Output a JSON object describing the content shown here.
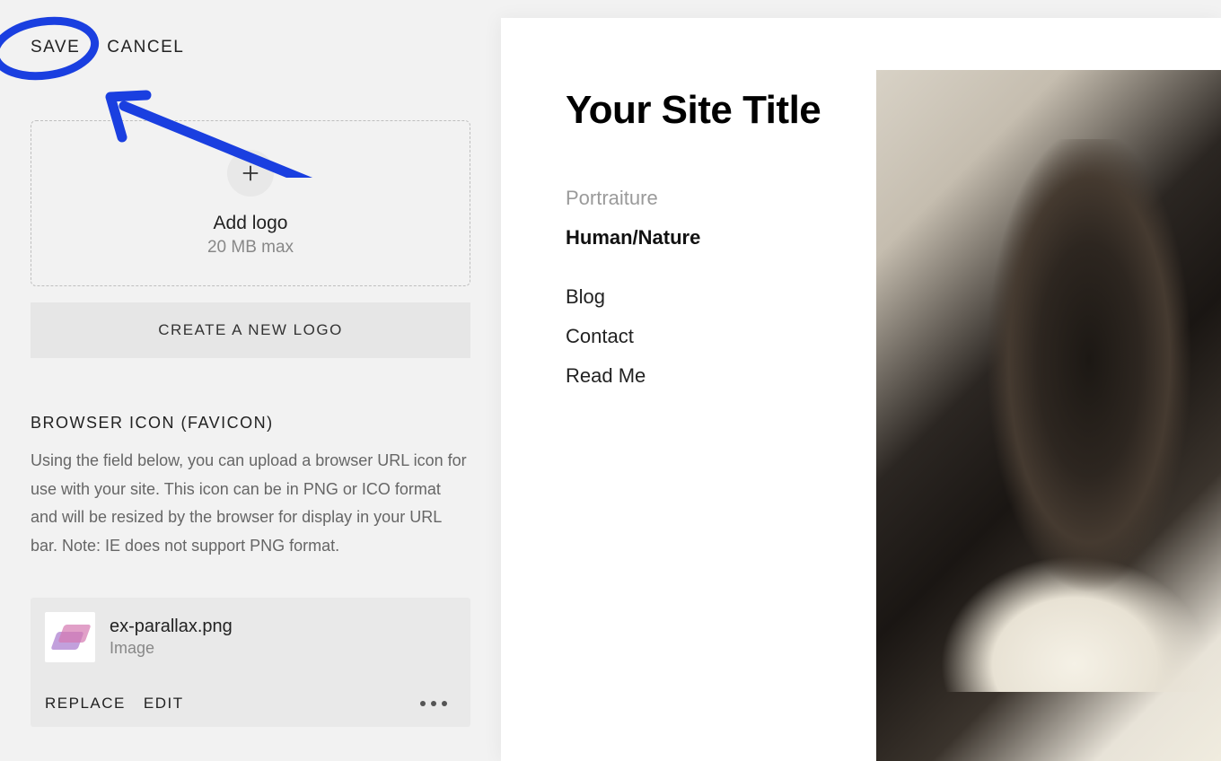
{
  "actions": {
    "save": "SAVE",
    "cancel": "CANCEL"
  },
  "logo_upload": {
    "title": "Add logo",
    "subtitle": "20 MB max",
    "create_button": "CREATE A NEW LOGO"
  },
  "favicon_section": {
    "heading": "BROWSER ICON (FAVICON)",
    "description": "Using the field below, you can upload a browser URL icon for use with your site. This icon can be in PNG or ICO format and will be resized by the browser for display in your URL bar. Note: IE does not support PNG format."
  },
  "file": {
    "name": "ex-parallax.png",
    "type": "Image",
    "actions": {
      "replace": "REPLACE",
      "edit": "EDIT"
    }
  },
  "preview": {
    "site_title": "Your Site Title",
    "nav": {
      "portraiture": "Portraiture",
      "human_nature": "Human/Nature",
      "blog": "Blog",
      "contact": "Contact",
      "read_me": "Read Me"
    }
  }
}
